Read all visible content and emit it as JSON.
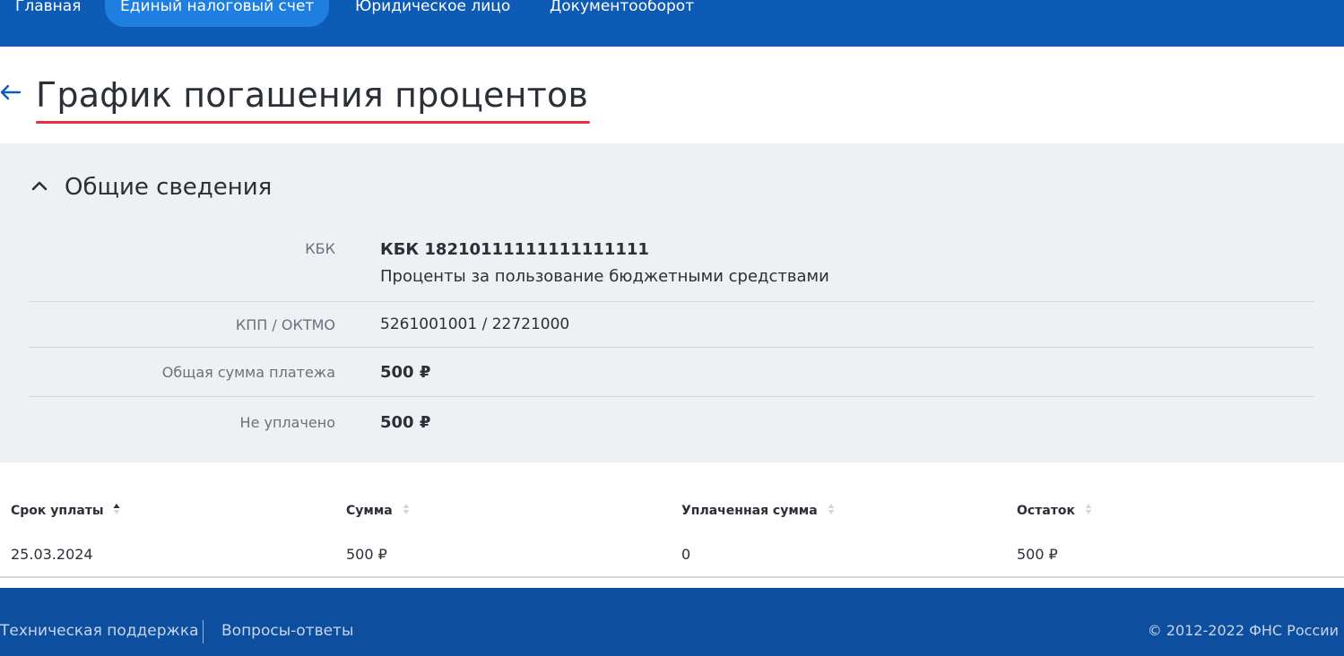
{
  "nav": {
    "items": [
      {
        "label": "Главная",
        "active": false
      },
      {
        "label": "Единый налоговый счет",
        "active": true
      },
      {
        "label": "Юридическое лицо",
        "active": false
      },
      {
        "label": "Документооборот",
        "active": false
      }
    ]
  },
  "page": {
    "back_icon": "arrow-left-icon",
    "title": "График погашения процентов"
  },
  "summary": {
    "title": "Общие сведения",
    "toggle_icon": "chevron-up-icon",
    "fields": [
      {
        "label": "КБК",
        "value": "КБК 18210111111111111111",
        "sub": "Проценты за пользование бюджетными средствами"
      },
      {
        "label": "КПП / ОКТМО",
        "value": "5261001001 / 22721000"
      },
      {
        "label": "Общая сумма платежа",
        "value": "500 ₽"
      },
      {
        "label": "Не уплачено",
        "value": "500 ₽"
      }
    ]
  },
  "table": {
    "columns": [
      {
        "label": "Срок уплаты",
        "sort": "asc"
      },
      {
        "label": "Сумма",
        "sort": "none"
      },
      {
        "label": "Уплаченная сумма",
        "sort": "none"
      },
      {
        "label": "Остаток",
        "sort": "none"
      }
    ],
    "rows": [
      [
        "25.03.2024",
        "500 ₽",
        "0",
        "500 ₽"
      ]
    ]
  },
  "footer": {
    "support": "Техническая поддержка",
    "faq": "Вопросы-ответы",
    "copyright": "© 2012-2022 ФНС России"
  },
  "colors": {
    "header_bg": "#0d5bb5",
    "nav_active_bg": "#1f7fe0",
    "title_underline": "#e5323a",
    "panel_bg": "#eef1f4",
    "footer_bg": "#0d4e9e"
  }
}
